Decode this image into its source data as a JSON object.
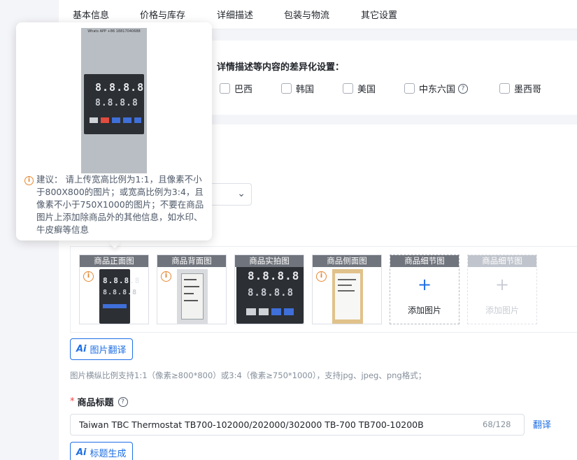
{
  "tabs": [
    "基本信息",
    "价格与库存",
    "详细描述",
    "包装与物流",
    "其它设置"
  ],
  "diff_section": {
    "title": "详情描述等内容的差异化设置：",
    "countries": [
      "巴西",
      "韩国",
      "美国",
      "中东六国",
      "墨西哥"
    ],
    "help_glyph": "?"
  },
  "images": {
    "slots": [
      {
        "label": "商品正面图",
        "has_image": true,
        "warning": true
      },
      {
        "label": "商品背面图",
        "has_image": true,
        "warning": true
      },
      {
        "label": "商品实拍图",
        "has_image": true,
        "warning": false
      },
      {
        "label": "商品侧面图",
        "has_image": true,
        "warning": true
      },
      {
        "label": "商品细节图",
        "has_image": false,
        "add_text": "添加图片"
      },
      {
        "label": "商品细节图",
        "has_image": false,
        "add_text": "添加图片",
        "disabled": true
      }
    ],
    "plus_glyph": "+",
    "warn_glyph": "i",
    "display_digits": "8.8.8.8",
    "translate_button": "图片翻译",
    "hint": "图片横纵比例支持1:1（像素≥800*800）或3:4（像素≥750*1000），支持jpg、jpeg、png格式；"
  },
  "popover": {
    "caption": "Whats APP +86 18817040688",
    "text": "建议： 请上传宽高比例为1:1，且像素不小于800X800的图片；或宽高比例为3:4，且像素不小于750X1000的图片；不要在商品图片上添加除商品外的其他信息，如水印、牛皮癣等信息"
  },
  "product_title": {
    "required_mark": "*",
    "label": "商品标题",
    "value": "Taiwan TBC Thermostat TB700-102000/202000/302000 TB-700 TB700-10200B",
    "counter": "68/128",
    "translate_link": "翻译",
    "generate_button": "标题生成"
  },
  "ai_mark": "Ai",
  "colors": {
    "accent": "#1f6fe5",
    "warning": "#e6862f",
    "required": "#f53f3f",
    "slot_label_bg": "#70747c"
  }
}
